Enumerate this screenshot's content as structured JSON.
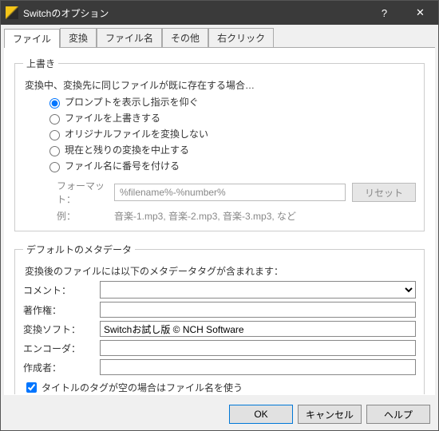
{
  "window": {
    "title": "Switchのオプション"
  },
  "tabs": [
    "ファイル",
    "変換",
    "ファイル名",
    "その他",
    "右クリック"
  ],
  "activeTab": 0,
  "overwrite": {
    "legend": "上書き",
    "desc": "変換中、変換先に同じファイルが既に存在する場合…",
    "options": [
      "プロンプトを表示し指示を仰ぐ",
      "ファイルを上書きする",
      "オリジナルファイルを変換しない",
      "現在と残りの変換を中止する",
      "ファイル名に番号を付ける"
    ],
    "selected": 0,
    "formatLabel": "フォーマット：",
    "formatValue": "%filename%-%number%",
    "resetLabel": "リセット",
    "exampleLabel": "例：",
    "exampleValue": "音楽-1.mp3, 音楽-2.mp3, 音楽-3.mp3, など"
  },
  "metadata": {
    "legend": "デフォルトのメタデータ",
    "desc": "変換後のファイルには以下のメタデータタグが含まれます：",
    "fields": {
      "commentLabel": "コメント：",
      "commentValue": "",
      "copyrightLabel": "著作権：",
      "copyrightValue": "",
      "softwareLabel": "変換ソフト：",
      "softwareValue": "Switchお試し版 © NCH Software",
      "encoderLabel": "エンコーダ：",
      "encoderValue": "",
      "authorLabel": "作成者：",
      "authorValue": ""
    },
    "useFilenameLabel": "タイトルのタグが空の場合はファイル名を使う",
    "useFilenameChecked": true
  },
  "buttons": {
    "ok": "OK",
    "cancel": "キャンセル",
    "help": "ヘルプ"
  }
}
